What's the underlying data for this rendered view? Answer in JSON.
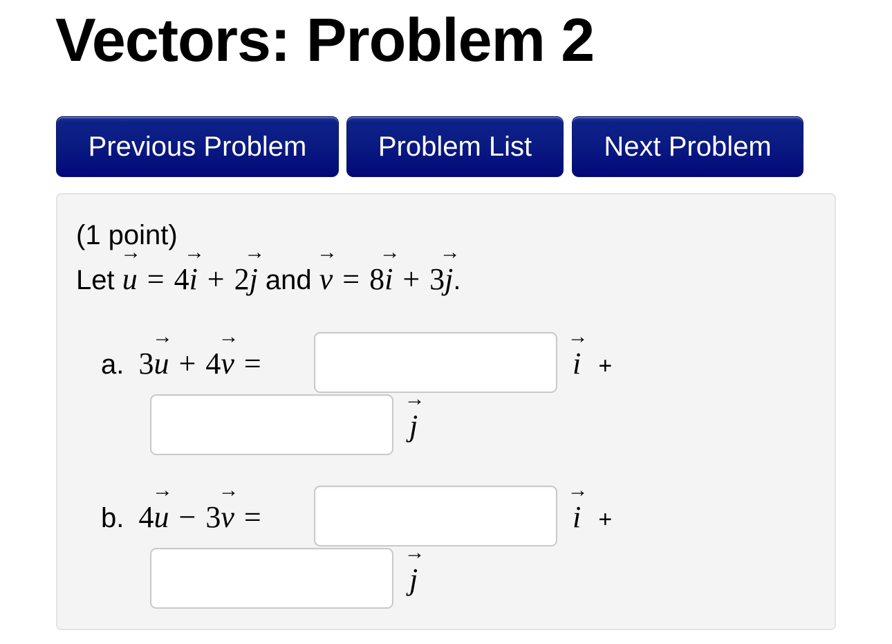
{
  "page": {
    "title": "Vectors: Problem 2"
  },
  "nav": {
    "previous_label": "Previous Problem",
    "list_label": "Problem List",
    "next_label": "Next Problem",
    "button_color": "#0a1a82"
  },
  "problem": {
    "points": "(1 point)",
    "statement": {
      "let": "Let",
      "u": "u",
      "eq": "=",
      "u_i_coef": "4",
      "plus": "+",
      "u_j_coef": "2",
      "and": "and",
      "v": "v",
      "v_i_coef": "8",
      "v_j_coef": "3",
      "i": "i",
      "j": "j",
      "period": "."
    },
    "parts": [
      {
        "label": "a.",
        "coef1": "3",
        "operator": "+",
        "coef2": "4",
        "equals": "=",
        "i_value": "",
        "j_value": "",
        "i_unit": "i",
        "j_unit": "j",
        "plus_text": "+"
      },
      {
        "label": "b.",
        "coef1": "4",
        "operator": "−",
        "coef2": "3",
        "equals": "=",
        "i_value": "",
        "j_value": "",
        "i_unit": "i",
        "j_unit": "j",
        "plus_text": "+"
      }
    ]
  }
}
